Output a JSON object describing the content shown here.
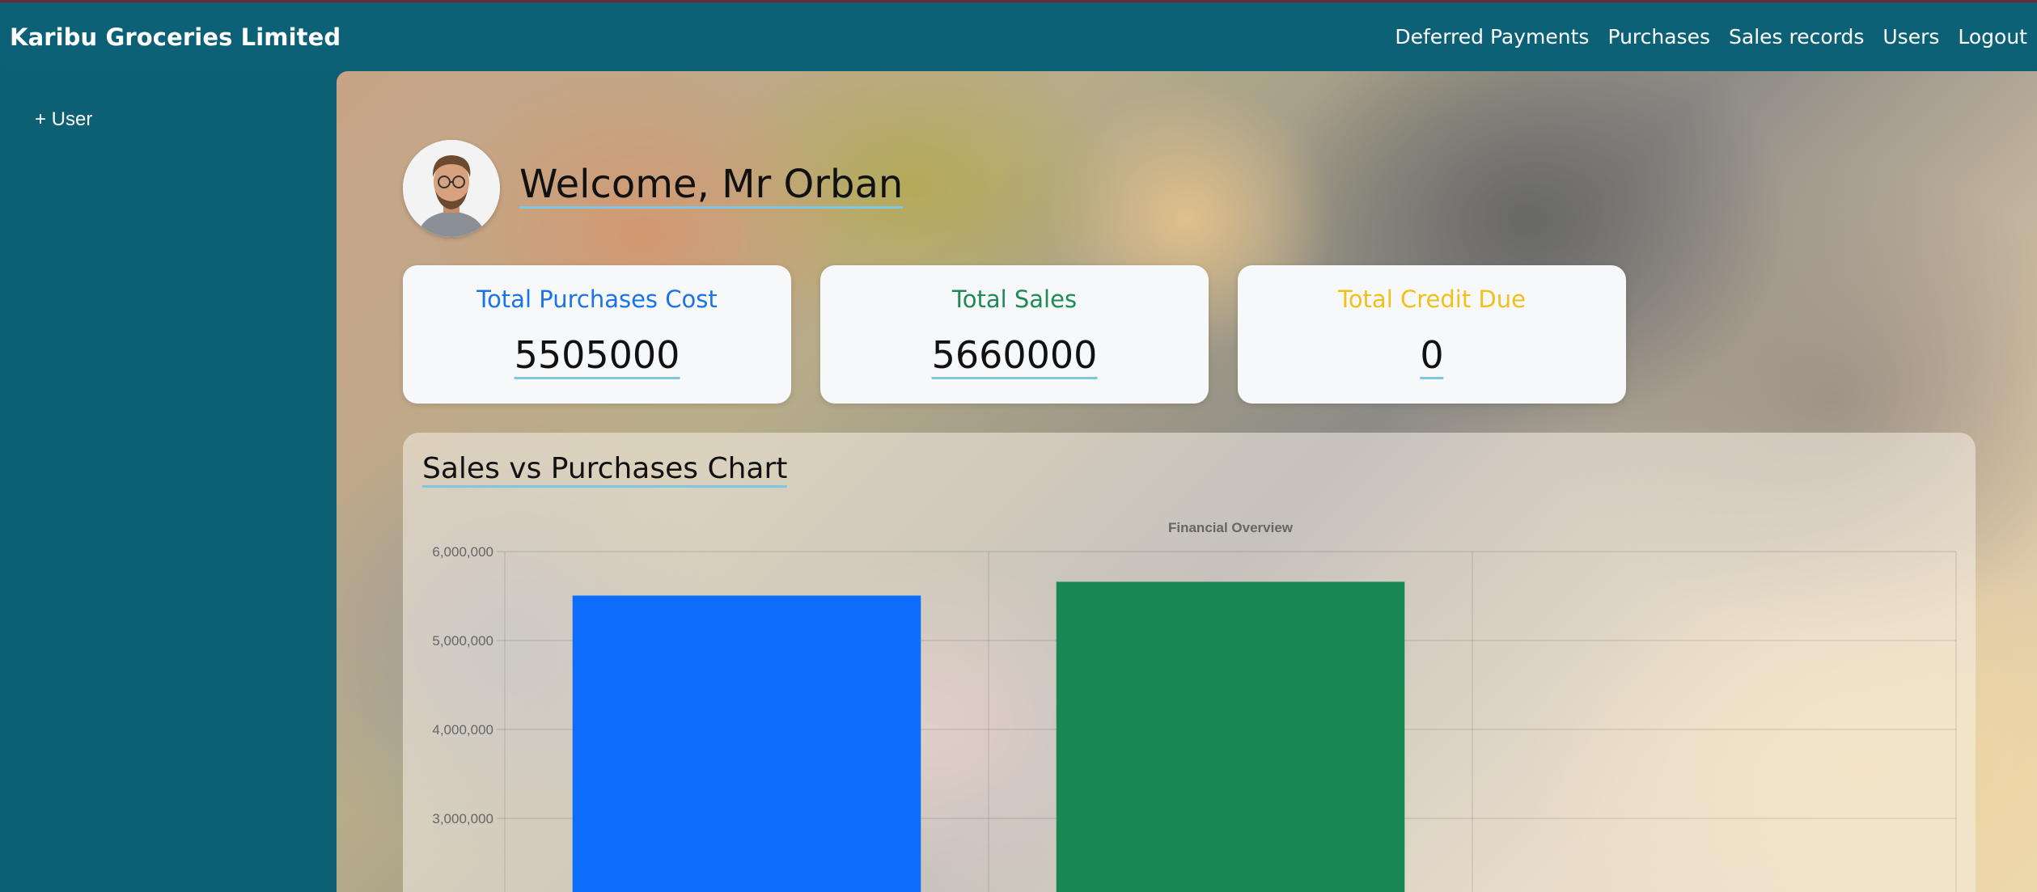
{
  "header": {
    "brand": "Karibu Groceries Limited",
    "nav": [
      "Deferred Payments",
      "Purchases",
      "Sales records",
      "Users",
      "Logout"
    ]
  },
  "sidebar": {
    "items": [
      "+ User"
    ]
  },
  "welcome": "Welcome, Mr Orban",
  "cards": [
    {
      "title": "Total Purchases Cost",
      "value": "5505000",
      "color": "#1a73e8"
    },
    {
      "title": "Total Sales",
      "value": "5660000",
      "color": "#1e8a57"
    },
    {
      "title": "Total Credit Due",
      "value": "0",
      "color": "#f2c01b"
    }
  ],
  "chart_section": {
    "title": "Sales vs Purchases Chart"
  },
  "chart_data": {
    "type": "bar",
    "title": "Financial Overview",
    "categories": [
      "",
      "",
      ""
    ],
    "values": [
      5505000,
      5660000,
      0
    ],
    "colors": [
      "#0d6efd",
      "#198754",
      "#ffc107"
    ],
    "ylim": [
      2000000,
      6000000
    ],
    "yticks": [
      "6,000,000",
      "5,000,000",
      "4,000,000",
      "3,000,000"
    ],
    "grid": true
  }
}
